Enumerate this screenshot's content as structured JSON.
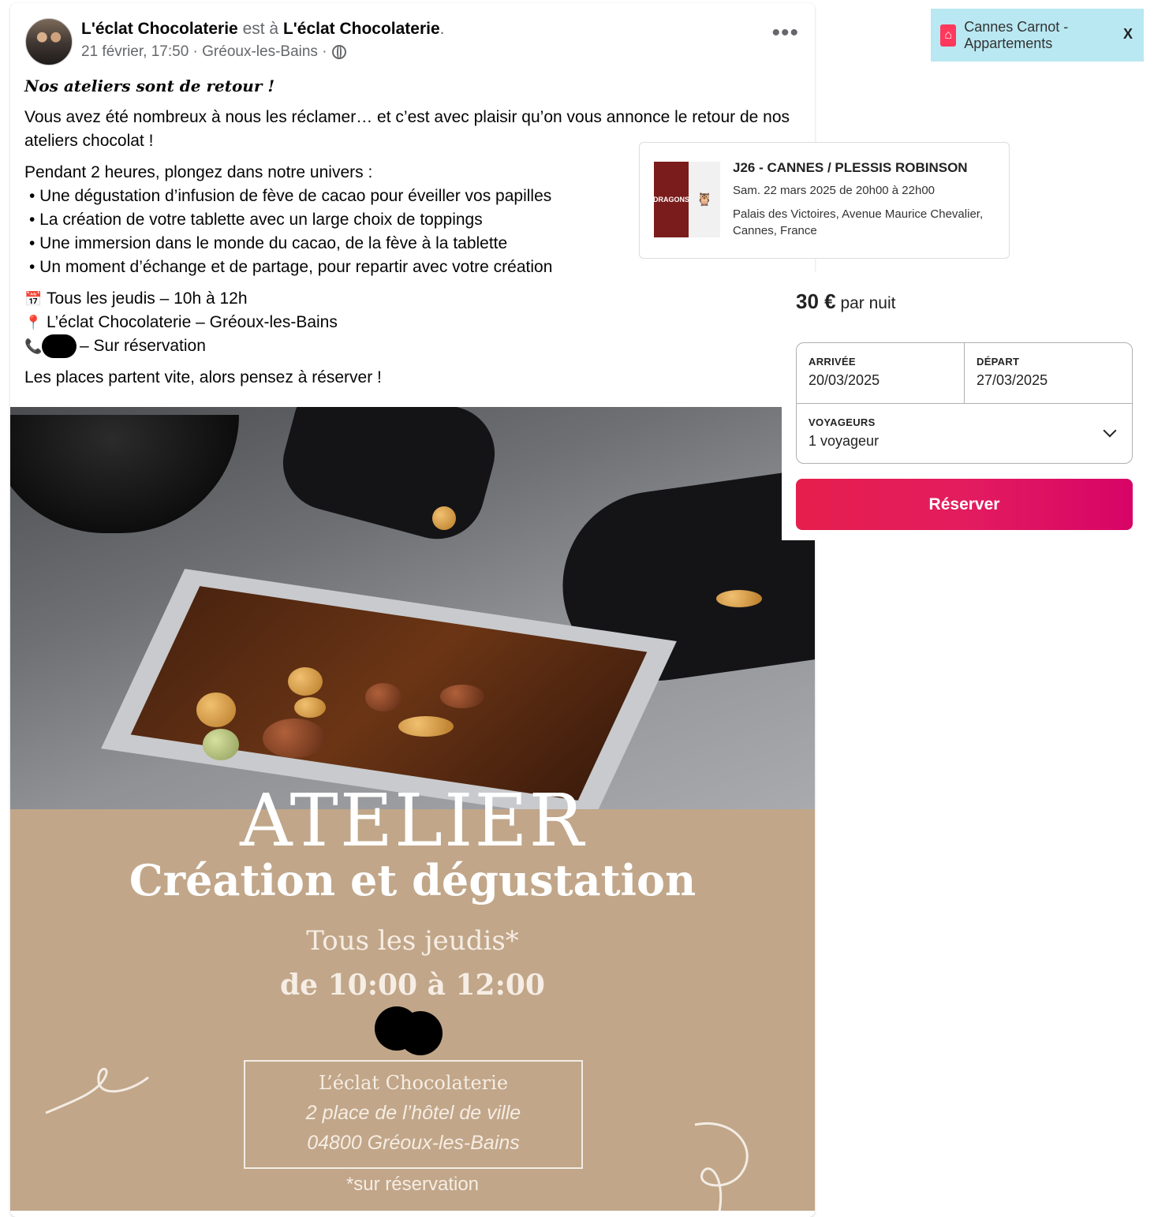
{
  "post": {
    "author_name": "L'éclat Chocolaterie",
    "connector": " est à ",
    "location_page": "L'éclat Chocolaterie",
    "period": ".",
    "date_location": "21 février, 17:50 · Gréoux-les-Bains ·",
    "more_label": "•••",
    "headline": "Nos ateliers sont de retour",
    "headline_suffix": " !",
    "intro": "Vous avez été nombreux à nous les réclamer… et c’est avec plaisir qu’on vous annonce le retour de nos ateliers chocolat !",
    "program_lead": "Pendant 2 heures, plongez dans notre univers :",
    "bullets": [
      "• Une dégustation d’infusion de fève de cacao pour  éveiller vos papilles",
      "• La création de votre tablette avec un large choix de toppings",
      "• Une immersion dans le monde du cacao, de la fève à la tablette",
      "• Un moment d’échange et de partage, pour repartir avec votre création"
    ],
    "schedule_icon": "📅",
    "schedule": "Tous les jeudis – 10h à 12h",
    "pin_icon": "📍",
    "place": "L’éclat Chocolaterie – Gréoux-les-Bains",
    "phone_icon": "📞",
    "phone_suffix": "– Sur réservation",
    "closing": "Les places partent vite, alors pensez à réserver !"
  },
  "poster": {
    "title": "ATELIER",
    "subtitle": "Création et dégustation",
    "days": "Tous les jeudis*",
    "hours": "de 10:00 à 12:00",
    "address_name": "L’éclat Chocolaterie",
    "address_street": "2 place de l’hôtel de ville",
    "address_city": "04800 Gréoux-les-Bains",
    "footnote": "*sur réservation"
  },
  "ad_banner": {
    "text": "Cannes Carnot - Appartements",
    "close_label": "X"
  },
  "event": {
    "title": "J26 - CANNES / PLESSIS ROBINSON",
    "date": "Sam. 22 mars 2025 de 20h00 à 22h00",
    "place": "Palais des Victoires, Avenue Maurice Chevalier, Cannes, France",
    "thumb_left_text": "DRAGONS",
    "thumb_right_icon": "owl-logo"
  },
  "booking": {
    "price": "30 €",
    "price_unit": " par nuit",
    "arrival_label": "ARRIVÉE",
    "arrival_value": "20/03/2025",
    "departure_label": "DÉPART",
    "departure_value": "27/03/2025",
    "guests_label": "VOYAGEURS",
    "guests_value": "1 voyageur",
    "reserve_label": "Réserver",
    "accent_color": "#e31c5f"
  }
}
